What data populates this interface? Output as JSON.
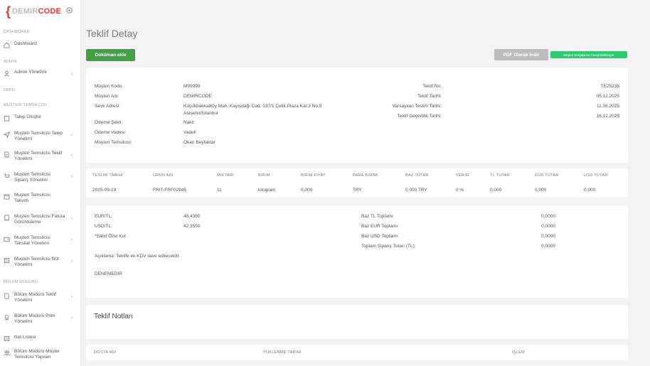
{
  "sidebar": {
    "logo_brace": "{",
    "logo_part1": "DEMIR",
    "logo_part2": "CODE",
    "sections": {
      "dashboard": "DASHBOARD",
      "admin": "ADMIN",
      "depo": "DEPO",
      "musteri": "MUŞTERI TEMSILCISI",
      "bolum": "BÖLÜM MÜDÜRÜ"
    },
    "items": {
      "dashboard": "Dashboard",
      "admin_yonetimi": "Admin Yönetimi",
      "talep_olustur": "Talep Oluştur",
      "mt_talep": "Muşteri Temsilcisi Talep Yönetimi",
      "mt_teklif": "Muşteri Temsilcisi Teklif Yönetimi",
      "mt_siparis": "Muşteri Temsilcisi Sipariş Yönetimi",
      "mt_takvim": "Muşteri Temsilcisi Takvim",
      "mt_fatura": "Muşteri Temsilcisi Fatura Görüntüleme",
      "mt_tahsilat": "Muşteri Temsilcisi Tahsilat Yönetimi",
      "mt_not": "Muşteri Temsilcisi Not Yönetimi",
      "bm_teklif": "Bölüm Müdürü Teklif Yönetimi",
      "bm_prim": "Bölüm Müdürü Prim Yönetimi",
      "not_listesi": "Not Listesi",
      "bm_musteri": "Bölüm Müdürü Müşter Temsilcisi Yapılan"
    }
  },
  "page": {
    "title": "Teklif Detay",
    "add_doc": "Doküman ekle",
    "pdf": "PDF Olarak İndir",
    "response": "Müşteri Dosyalarına Cevap Bekleniyor"
  },
  "info": {
    "musteri_kodu_label": "Müşteri Kodu:",
    "musteri_kodu": "M99999",
    "musteri_adi_label": "Müşteri Adı:",
    "musteri_adi": "DEMIRCODE",
    "sevk_label": "Sevk Adresi:",
    "sevk_line1": "Küçükbakkalköy Mah. Kayışdağı Cad. 137/1 Çelik Plaza Kat:3 No:9",
    "sevk_line2": "Ataşehir/İstanbul",
    "odeme_sekli_label": "Ödeme Şekli:",
    "odeme_sekli": "Nakit",
    "odeme_vadesi_label": "Ödeme Vadesi:",
    "odeme_vadesi": "Vadeli",
    "temsilci_label": "Müşteri Temsilcisi:",
    "temsilci": "Okan Beyfaktar",
    "teklif_no_label": "Teklif No:",
    "teklif_no": "TE25235",
    "teklif_tarihi_label": "Teklif Tarihi:",
    "teklif_tarihi": "05.12.2025",
    "teslim_label": "Varsayılan Teslim Tarihi:",
    "teslim": "11.06.2025",
    "gecerlilik_label": "Teklif Geçerlilik Tarihi:",
    "gecerlilik": "16.12.2025"
  },
  "items_table": {
    "headers": [
      "TESLIM TARIHI",
      "ÜRÜN ADI",
      "MIKTARI",
      "BIRIM",
      "BIRIM FIYAT",
      "PARA BIRIMI",
      "BAZ TUTAR",
      "VERGI",
      "TL TUTAR",
      "EUR TUTAR",
      "USD TUTAR"
    ],
    "row": [
      "2025-09-19",
      "FRIT-FRF02945",
      "11",
      "kilogram",
      "0,000",
      "TRY",
      "0,000 TRY",
      "0 %",
      "0,000",
      "0,000",
      "0,000"
    ]
  },
  "totals": {
    "eur_label": "EUR/TL:",
    "eur": "48,4360",
    "usd_label": "USD/TL:",
    "usd": "42,3550",
    "ozel_kur": "*Sabit Özel Kur",
    "aciklama": "Açıklama: Teklife ek KDV ilave edilecektir.",
    "note": "DENEMEDIR",
    "baz_tl_label": "Baz TL Toplamı:",
    "baz_tl": "0,0000",
    "baz_eur_label": "Baz EUR Toplamı:",
    "baz_eur": "0,0000",
    "baz_usd_label": "Baz USD Toplamı:",
    "baz_usd": "0,0000",
    "toplam_label": "Toplam Sipariş Tutarı (TL):",
    "toplam": "0,0000"
  },
  "notes": {
    "title": "Teklif Notları",
    "col_dosya": "DOSYA ADI",
    "col_tarih": "YÜKLENME TARIHI",
    "col_islem": "İŞLEM"
  }
}
